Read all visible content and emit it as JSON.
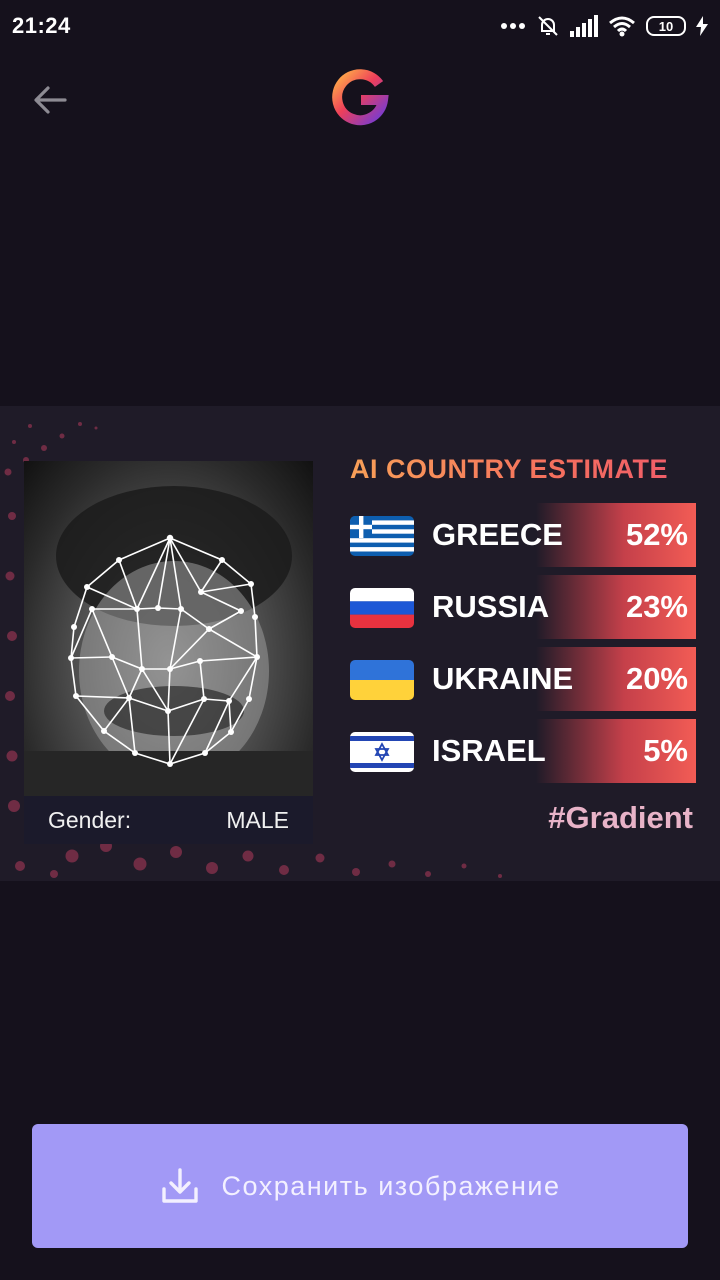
{
  "status_bar": {
    "time": "21:24",
    "battery": "10",
    "icons": [
      "more-dots-icon",
      "bell-muted-icon",
      "signal-icon",
      "wifi-icon",
      "battery-icon",
      "charging-icon"
    ]
  },
  "header": {
    "back_icon": "back-arrow-icon",
    "logo_icon": "gradient-logo-icon"
  },
  "card": {
    "title": "AI COUNTRY ESTIMATE",
    "countries": [
      {
        "name": "GREECE",
        "percent": "52%",
        "flag": "greece-flag-icon"
      },
      {
        "name": "RUSSIA",
        "percent": "23%",
        "flag": "russia-flag-icon"
      },
      {
        "name": "UKRAINE",
        "percent": "20%",
        "flag": "ukraine-flag-icon"
      },
      {
        "name": "ISRAEL",
        "percent": "5%",
        "flag": "israel-flag-icon"
      }
    ],
    "gender_label": "Gender:",
    "gender_value": "MALE",
    "hashtag": "#Gradient"
  },
  "actions": {
    "save_label": "Сохранить изображение",
    "save_icon": "download-icon"
  },
  "colors": {
    "background": "#15111c",
    "card": "#1f1b28",
    "accent_button": "#a299f6",
    "bar_red": "#f25c55",
    "title_orange": "#f8a058"
  }
}
